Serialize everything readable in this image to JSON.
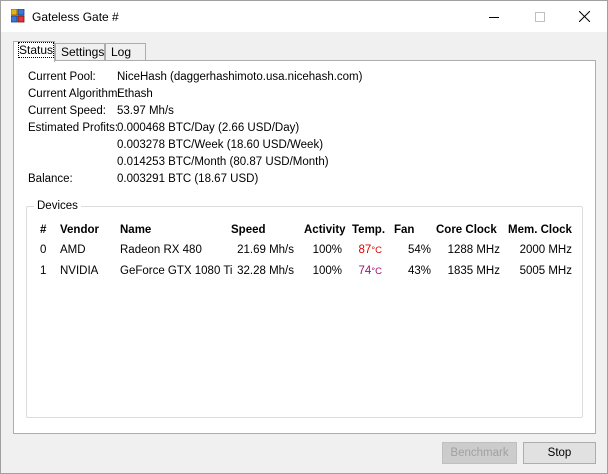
{
  "window": {
    "title": "Gateless Gate #"
  },
  "tabs": [
    {
      "label": "Status",
      "active": true
    },
    {
      "label": "Settings",
      "active": false
    },
    {
      "label": "Log",
      "active": false
    }
  ],
  "status": {
    "pool_label": "Current Pool:",
    "pool_value": "NiceHash (daggerhashimoto.usa.nicehash.com)",
    "algorithm_label": "Current Algorithm:",
    "algorithm_value": "Ethash",
    "speed_label": "Current Speed:",
    "speed_value": "53.97 Mh/s",
    "profits_label": "Estimated Profits:",
    "profit_day": "0.000468 BTC/Day (2.66 USD/Day)",
    "profit_week": "0.003278 BTC/Week (18.60 USD/Week)",
    "profit_month": "0.014253 BTC/Month (80.87 USD/Month)",
    "balance_label": "Balance:",
    "balance_value": "0.003291 BTC (18.67 USD)"
  },
  "devices": {
    "group_title": "Devices",
    "columns": {
      "index": "#",
      "vendor": "Vendor",
      "name": "Name",
      "speed": "Speed",
      "activity": "Activity",
      "temp": "Temp.",
      "fan": "Fan",
      "core_clock": "Core Clock",
      "mem_clock": "Mem. Clock"
    },
    "rows": [
      {
        "index": "0",
        "vendor": "AMD",
        "name": "Radeon  RX 480",
        "speed": "21.69 Mh/s",
        "activity": "100%",
        "temp": "87",
        "temp_unit": "°C",
        "temp_color": "#e00000",
        "fan": "54%",
        "core_clock": "1288 MHz",
        "mem_clock": "2000 MHz"
      },
      {
        "index": "1",
        "vendor": "NVIDIA",
        "name": "GeForce GTX 1080 Ti",
        "speed": "32.28 Mh/s",
        "activity": "100%",
        "temp": "74",
        "temp_unit": "°C",
        "temp_color": "#a0107a",
        "fan": "43%",
        "core_clock": "1835 MHz",
        "mem_clock": "5005 MHz"
      }
    ]
  },
  "buttons": {
    "benchmark": "Benchmark",
    "stop": "Stop"
  }
}
